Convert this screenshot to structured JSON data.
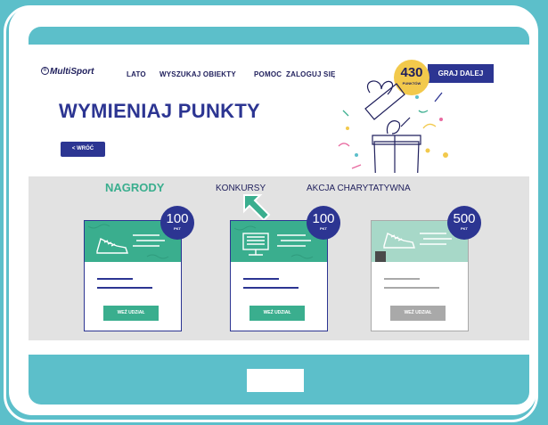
{
  "brand": {
    "logo": "MultiSport",
    "logo_mark": "®"
  },
  "nav": {
    "items": [
      "LATO",
      "WYSZUKAJ OBIEKTY",
      "POMOC",
      "ZALOGUJ SIĘ"
    ]
  },
  "points": {
    "value": "430",
    "label": "PUNKTÓW"
  },
  "play_button": "GRAJ DALEJ",
  "page_title": "WYMIENIAJ PUNKTY",
  "back_button": "< WRÓĆ",
  "tabs": [
    "NAGRODY",
    "KONKURSY",
    "AKCJA CHARYTATYWNA"
  ],
  "active_tab": "NAGRODY",
  "cards": [
    {
      "icon": "sneaker-icon",
      "points": "100",
      "unit": "PKT",
      "cta": "WEŹ UDZIAŁ",
      "locked": false
    },
    {
      "icon": "monitor-icon",
      "points": "100",
      "unit": "PKT",
      "cta": "WEŹ UDZIAŁ",
      "locked": false
    },
    {
      "icon": "sneaker-icon",
      "points": "500",
      "unit": "PKT",
      "cta": "WEŹ UDZIAŁ",
      "locked": true
    }
  ],
  "colors": {
    "teal_frame": "#5cbfca",
    "navy": "#2c3592",
    "green": "#3aae8e",
    "gold": "#f2c94c",
    "gray_bg": "#e2e2e2"
  }
}
